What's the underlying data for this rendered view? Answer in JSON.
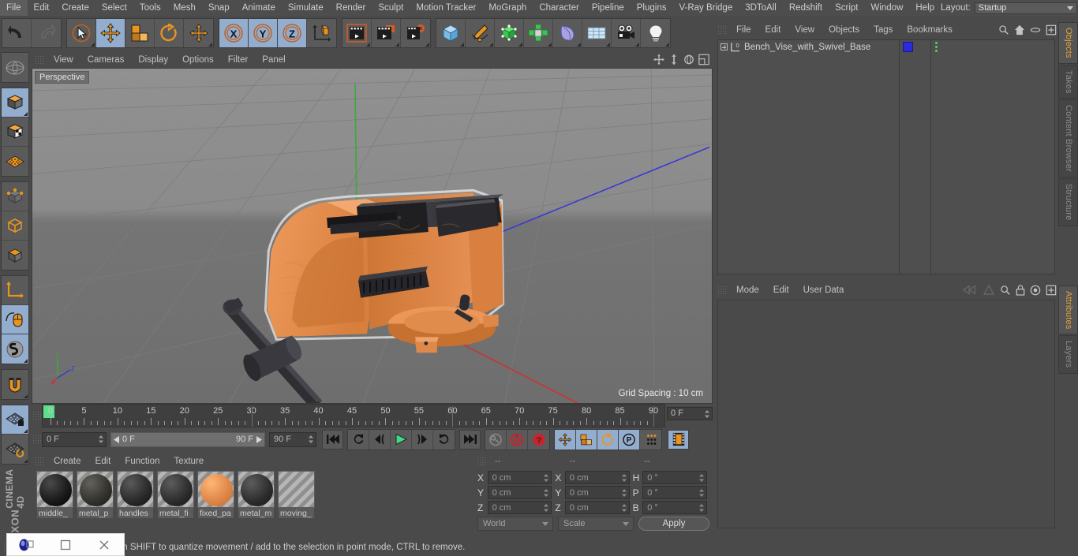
{
  "app": {
    "brand_top": "MAXON",
    "brand_bottom": "CINEMA 4D"
  },
  "top_menu": {
    "items": [
      "File",
      "Edit",
      "Create",
      "Select",
      "Tools",
      "Mesh",
      "Snap",
      "Animate",
      "Simulate",
      "Render",
      "Sculpt",
      "Motion Tracker",
      "MoGraph",
      "Character",
      "Pipeline",
      "Plugins",
      "V-Ray Bridge",
      "3DToAll",
      "Redshift",
      "Script",
      "Window",
      "Help"
    ],
    "layout_label": "Layout:",
    "layout_value": "Startup",
    "right_icons": [
      "search-icon"
    ]
  },
  "toolbar": {
    "groups": [
      {
        "name": "undo-redo",
        "buttons": [
          {
            "icon": "undo-icon",
            "label": "Undo",
            "active": false
          },
          {
            "icon": "redo-icon",
            "label": "Redo",
            "active": false
          }
        ]
      },
      {
        "name": "transform-tools",
        "buttons": [
          {
            "icon": "select-live-icon",
            "label": "Live Selection",
            "active": false
          },
          {
            "icon": "move-icon",
            "label": "Move",
            "active": true
          },
          {
            "icon": "scale-icon",
            "label": "Scale",
            "active": false
          },
          {
            "icon": "rotate-icon",
            "label": "Rotate",
            "active": false
          },
          {
            "icon": "move-alt-icon",
            "label": "Move Alt",
            "active": false
          }
        ]
      },
      {
        "name": "axis-locks",
        "buttons": [
          {
            "icon": "axis-x-icon",
            "label": "X",
            "active": true
          },
          {
            "icon": "axis-y-icon",
            "label": "Y",
            "active": true
          },
          {
            "icon": "axis-z-icon",
            "label": "Z",
            "active": true
          },
          {
            "icon": "world-object-axis-icon",
            "label": "World/Object",
            "active": false
          }
        ]
      },
      {
        "name": "render-tools",
        "buttons": [
          {
            "icon": "render-view-icon",
            "label": "Render View",
            "active": false
          },
          {
            "icon": "render-picture-viewer-icon",
            "label": "Render to Picture Viewer",
            "active": false
          },
          {
            "icon": "render-settings-icon",
            "label": "Edit Render Settings",
            "active": false
          }
        ]
      },
      {
        "name": "create-objects",
        "buttons": [
          {
            "icon": "cube-primitive-icon",
            "label": "Cube",
            "active": false
          },
          {
            "icon": "pen-spline-icon",
            "label": "Spline Pen",
            "active": false
          },
          {
            "icon": "nurbs-icon",
            "label": "Subdivision Surface",
            "active": false
          },
          {
            "icon": "mograph-cloner-icon",
            "label": "MoGraph Cloner",
            "active": false
          },
          {
            "icon": "deformer-icon",
            "label": "Bend Deformer",
            "active": false
          },
          {
            "icon": "scene-floor-icon",
            "label": "Floor / Environment",
            "active": false
          },
          {
            "icon": "camera-icon",
            "label": "Camera",
            "active": false
          },
          {
            "icon": "light-icon",
            "label": "Light",
            "active": false
          }
        ]
      }
    ]
  },
  "left_toolbar": {
    "groups": [
      {
        "buttons": [
          {
            "icon": "uv-globe-icon",
            "label": "Make Editable / UV",
            "active": false
          }
        ]
      },
      {
        "buttons": [
          {
            "icon": "model-mode-icon",
            "label": "Model Mode",
            "active": true
          },
          {
            "icon": "texture-mode-icon",
            "label": "Texture Mode",
            "active": false
          },
          {
            "icon": "workplane-mode-icon",
            "label": "Workplane Mode",
            "active": false
          }
        ]
      },
      {
        "buttons": [
          {
            "icon": "points-mode-icon",
            "label": "Points Mode",
            "active": false
          },
          {
            "icon": "edges-mode-icon",
            "label": "Edges Mode",
            "active": false
          },
          {
            "icon": "polygons-mode-icon",
            "label": "Polygons Mode",
            "active": false
          }
        ]
      },
      {
        "buttons": [
          {
            "icon": "axis-modify-icon",
            "label": "Enable Axis Modification",
            "active": false
          },
          {
            "icon": "viewport-solo-icon",
            "label": "Enable Snapping Mouse",
            "active": true
          },
          {
            "icon": "soft-selection-icon",
            "label": "Soft Selection",
            "active": true
          }
        ]
      },
      {
        "buttons": [
          {
            "icon": "magnet-icon",
            "label": "Magnet",
            "active": false
          }
        ]
      },
      {
        "buttons": [
          {
            "icon": "workplane-lock-icon",
            "label": "Lock Workplane",
            "active": true
          },
          {
            "icon": "workplane-reset-icon",
            "label": "Reset Workplane",
            "active": false
          }
        ]
      }
    ]
  },
  "viewport": {
    "menu": [
      "View",
      "Cameras",
      "Display",
      "Options",
      "Filter",
      "Panel"
    ],
    "corner_icons": [
      "pan-icon",
      "dolly-icon",
      "rotate-view-icon",
      "maximize-view-icon"
    ],
    "label": "Perspective",
    "grid_spacing": "Grid Spacing : 10 cm",
    "axis_gizmo": {
      "x": "X",
      "y": "Y",
      "z": "Z"
    },
    "colors": {
      "x_axis": "#cc3b3b",
      "y_axis": "#3bb03b",
      "z_axis": "#3b3bcc",
      "model_orange": "#e08a4e",
      "model_dark": "#333333"
    }
  },
  "timeline": {
    "ticks": [
      0,
      5,
      10,
      15,
      20,
      25,
      30,
      35,
      40,
      45,
      50,
      55,
      60,
      65,
      70,
      75,
      80,
      85,
      90
    ],
    "min": 0,
    "max": 90,
    "current_frame_field": "0 F",
    "playhead_frame": 0
  },
  "transport": {
    "current_frame": "0 F",
    "range_start": "0 F",
    "range_end": "90 F",
    "end_frame": "90 F",
    "buttons": [
      {
        "icon": "go-to-start-icon",
        "label": "Go to Start",
        "active": false
      },
      {
        "icon": "step-back-keyframe-icon",
        "label": "Go to Previous Key",
        "active": false
      },
      {
        "icon": "step-back-icon",
        "label": "Go to Previous Frame",
        "active": false
      },
      {
        "icon": "play-icon",
        "label": "Play",
        "active": false
      },
      {
        "icon": "step-forward-icon",
        "label": "Go to Next Frame",
        "active": false
      },
      {
        "icon": "step-forward-keyframe-icon",
        "label": "Go to Next Key",
        "active": false
      },
      {
        "icon": "go-to-end-icon",
        "label": "Go to End",
        "active": false
      },
      {
        "icon": "record-auto-key-icon",
        "label": "Autokeying",
        "active": false
      },
      {
        "icon": "record-active-objects-icon",
        "label": "Record Active Objects",
        "active": false
      },
      {
        "icon": "keyframe-selection-icon",
        "label": "Keyframe Selection",
        "active": false
      },
      {
        "icon": "key-position-icon",
        "label": "Position",
        "active": true
      },
      {
        "icon": "key-scale-icon",
        "label": "Scale",
        "active": true
      },
      {
        "icon": "key-rotation-icon",
        "label": "Rotation",
        "active": true
      },
      {
        "icon": "key-param-icon",
        "label": "Parameter",
        "active": true
      },
      {
        "icon": "key-pla-icon",
        "label": "Point Level Animation",
        "active": false
      },
      {
        "icon": "timeline-mode-icon",
        "label": "Timeline Mode",
        "active": true
      }
    ]
  },
  "material_manager": {
    "menu": [
      "Create",
      "Edit",
      "Function",
      "Texture"
    ],
    "materials": [
      {
        "name": "middle_",
        "color": "#1c1c1c",
        "selected": false
      },
      {
        "name": "metal_p",
        "color": "#35342f",
        "selected": false
      },
      {
        "name": "handles",
        "color": "#2c2c2c",
        "selected": false
      },
      {
        "name": "metal_fi",
        "color": "#2f2f2f",
        "selected": false
      },
      {
        "name": "fixed_pa",
        "color": "#e0884a",
        "selected": false
      },
      {
        "name": "metal_m",
        "color": "#2f2f2f",
        "selected": false
      },
      {
        "name": "moving_",
        "color": "",
        "selected": false
      }
    ]
  },
  "coordinates": {
    "header_dashes": [
      "--",
      "--",
      "--"
    ],
    "rows": [
      {
        "pos_label": "X",
        "pos_value": "0 cm",
        "size_label": "X",
        "size_value": "0 cm",
        "rot_label": "H",
        "rot_value": "0 °"
      },
      {
        "pos_label": "Y",
        "pos_value": "0 cm",
        "size_label": "Y",
        "size_value": "0 cm",
        "rot_label": "P",
        "rot_value": "0 °"
      },
      {
        "pos_label": "Z",
        "pos_value": "0 cm",
        "size_label": "Z",
        "size_value": "0 cm",
        "rot_label": "B",
        "rot_value": "0 °"
      }
    ],
    "system": "World",
    "mode": "Scale",
    "apply_label": "Apply"
  },
  "object_manager": {
    "menu": [
      "File",
      "Edit",
      "View",
      "Objects",
      "Tags",
      "Bookmarks"
    ],
    "right_icons": [
      "search-icon",
      "home-icon",
      "ellipse-icon",
      "plus-box-icon"
    ],
    "items": [
      {
        "name": "Bench_Vise_with_Swivel_Base",
        "expandable": true,
        "layer_color": "#2b2bdd",
        "tag_dots": 3
      }
    ]
  },
  "attributes": {
    "menu": [
      "Mode",
      "Edit",
      "User Data"
    ],
    "right_icons": [
      "prev-icon",
      "next-icon",
      "search-icon",
      "lock-icon",
      "target-icon",
      "plus-box-icon"
    ]
  },
  "right_tabs": {
    "upper": [
      {
        "label": "Objects",
        "active": true
      },
      {
        "label": "Takes",
        "active": false
      },
      {
        "label": "Content Browser",
        "active": false
      },
      {
        "label": "Structure",
        "active": false
      }
    ],
    "lower": [
      {
        "label": "Attributes",
        "active": true
      },
      {
        "label": "Layers",
        "active": false
      }
    ]
  },
  "status_bar": {
    "text": "Move elements. Hold down SHIFT to quantize movement / add to the selection in point mode, CTRL to remove."
  },
  "taskbar": {
    "items": [
      {
        "icon": "c4d-app-icon",
        "label": "Cinema 4D"
      },
      {
        "icon": "restore-window-icon",
        "label": "Restore"
      },
      {
        "icon": "close-window-icon",
        "label": "Close"
      }
    ]
  }
}
